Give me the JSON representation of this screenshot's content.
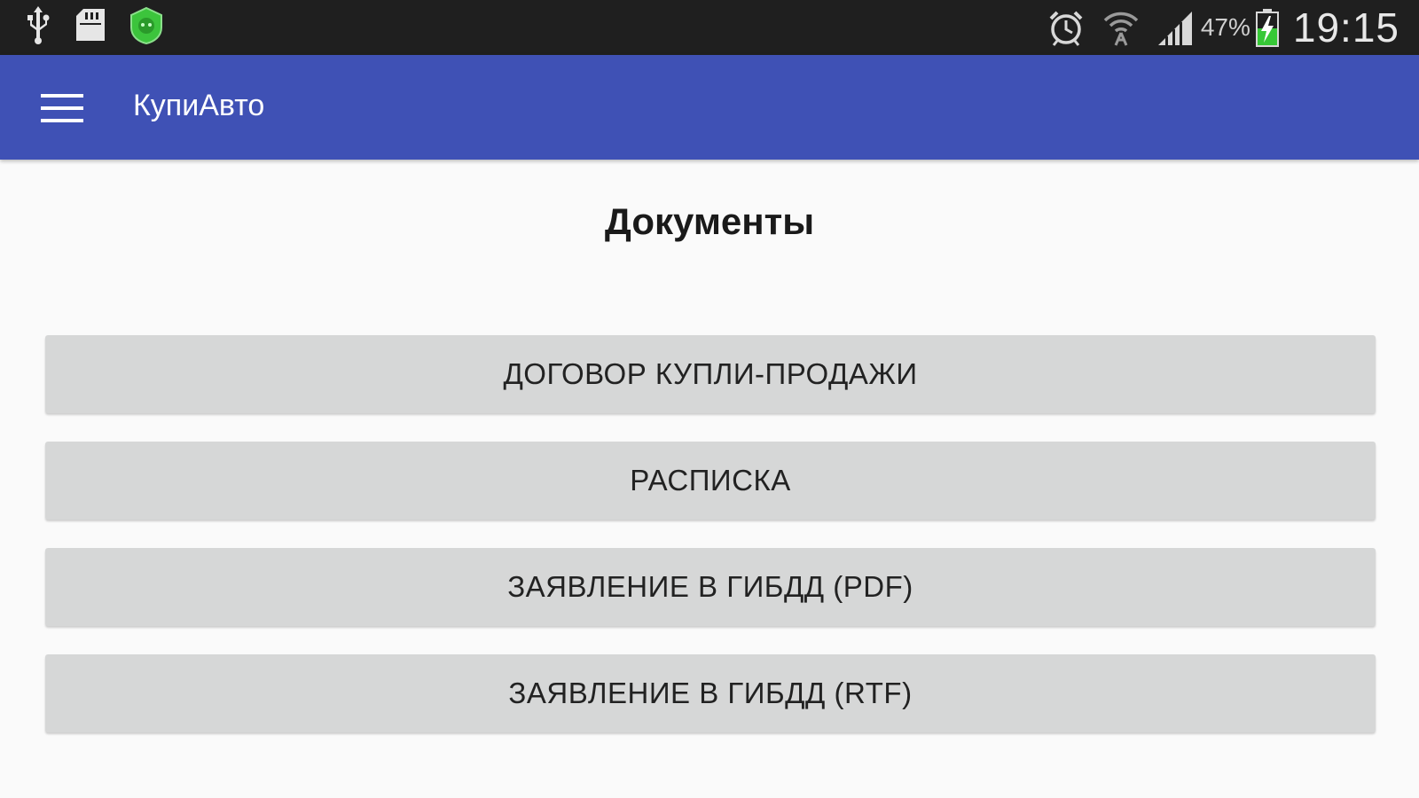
{
  "status_bar": {
    "left_icons": [
      "usb-icon",
      "sd-card-icon",
      "security-shield-icon"
    ],
    "right_icons": [
      "alarm-clock-icon",
      "wifi-icon",
      "cell-signal-icon",
      "battery-charging-icon"
    ],
    "battery_percent": "47%",
    "time": "19:15"
  },
  "app_bar": {
    "menu_icon": "hamburger-menu-icon",
    "title": "КупиАвто",
    "background": "#3f51b5"
  },
  "main": {
    "heading": "Документы",
    "buttons": [
      {
        "label": "ДОГОВОР КУПЛИ-ПРОДАЖИ"
      },
      {
        "label": "РАСПИСКА"
      },
      {
        "label": "ЗАЯВЛЕНИЕ В ГИБДД (PDF)"
      },
      {
        "label": "ЗАЯВЛЕНИЕ В ГИБДД (RTF)"
      }
    ]
  }
}
